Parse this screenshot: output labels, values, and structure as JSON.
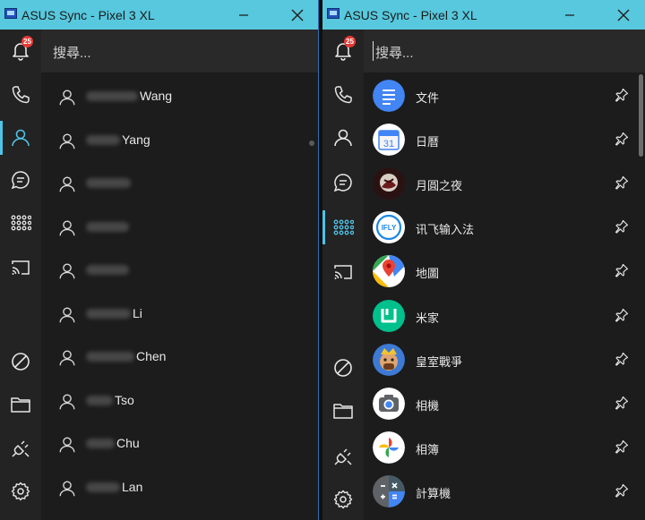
{
  "left_window": {
    "title": "ASUS Sync - Pixel 3 XL",
    "notification_count": "25",
    "search_placeholder": "搜尋...",
    "contacts": [
      {
        "name": "Wang"
      },
      {
        "name": "Yang"
      },
      {
        "name": ""
      },
      {
        "name": ""
      },
      {
        "name": ""
      },
      {
        "name": "Li"
      },
      {
        "name": "Chen"
      },
      {
        "name": "Tso"
      },
      {
        "name": "Chu"
      },
      {
        "name": "Lan"
      }
    ]
  },
  "right_window": {
    "title": "ASUS Sync - Pixel 3 XL",
    "notification_count": "25",
    "search_placeholder": "搜尋...",
    "apps": [
      {
        "label": "文件",
        "icon": "docs-icon"
      },
      {
        "label": "日曆",
        "icon": "calendar-icon",
        "badge_text": "31"
      },
      {
        "label": "月圓之夜",
        "icon": "moon-night-game-icon"
      },
      {
        "label": "讯飞输入法",
        "icon": "iflytek-icon",
        "badge_text": "IFLY"
      },
      {
        "label": "地圖",
        "icon": "maps-icon"
      },
      {
        "label": "米家",
        "icon": "mijia-icon"
      },
      {
        "label": "皇室戰爭",
        "icon": "clash-royale-icon"
      },
      {
        "label": "相機",
        "icon": "camera-icon"
      },
      {
        "label": "相簿",
        "icon": "photos-icon"
      },
      {
        "label": "計算機",
        "icon": "calculator-icon"
      }
    ]
  },
  "colors": {
    "titlebar": "#57c8de",
    "accent": "#4fc3e8",
    "badge": "#e53935",
    "sidebar_bg": "#232323",
    "content_bg": "#1c1c1c"
  }
}
